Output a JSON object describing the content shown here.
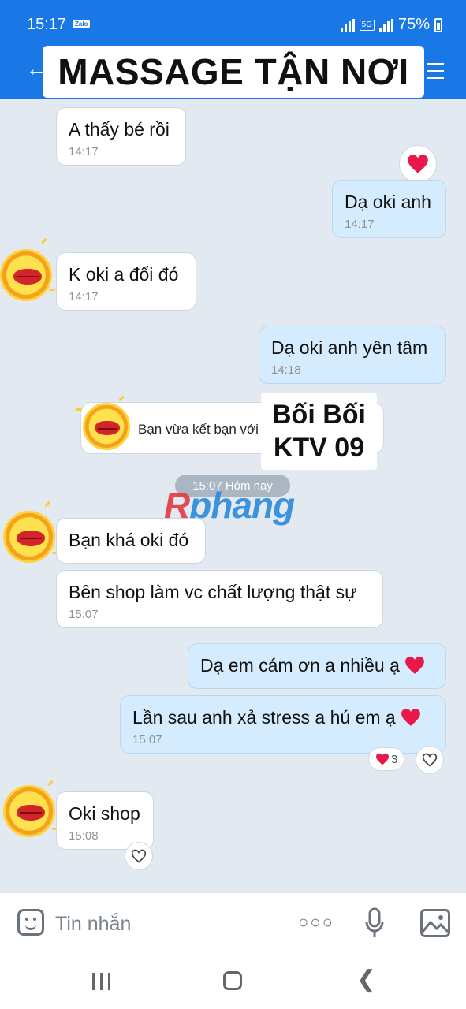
{
  "status_bar": {
    "time": "15:17",
    "app_badge": "Zalo",
    "network": "5G",
    "battery": "75%"
  },
  "header": {
    "title": "MASSAGE TẬN NƠI"
  },
  "messages": [
    {
      "side": "in",
      "text": "A thấy bé rồi",
      "time": "14:17"
    },
    {
      "side": "out",
      "text": "Dạ oki anh",
      "time": "14:17"
    },
    {
      "side": "in",
      "text": "K oki a đổi đó",
      "time": "14:17"
    },
    {
      "side": "out",
      "text": "Dạ oki anh yên tâm",
      "time": "14:18"
    },
    {
      "side": "in",
      "text": "Bạn khá oki đó",
      "time": ""
    },
    {
      "side": "in",
      "text": "Bên shop làm vc chất lượng thật sự",
      "time": "15:07"
    },
    {
      "side": "out",
      "text": "Dạ em cám ơn a nhiều ạ",
      "time": ""
    },
    {
      "side": "out",
      "text": "Lần sau anh xả stress a hú em ạ",
      "time": "15:07"
    },
    {
      "side": "in",
      "text": "Oki shop",
      "time": "15:08"
    }
  ],
  "friend_notice": {
    "text": "Bạn vừa kết bạn với",
    "name_line1": "Bối Bối",
    "name_line2": "KTV 09"
  },
  "date_divider": "15:07 Hôm nay",
  "watermark": {
    "part1": "R",
    "part2": "phang"
  },
  "reaction_count": "3",
  "input": {
    "placeholder": "Tin nhắn"
  },
  "icons": {
    "more": "more-icon",
    "mic": "mic-icon",
    "image": "image-icon",
    "emoji": "emoji-icon"
  },
  "colors": {
    "header_blue": "#1a78e6",
    "outgoing_bubble": "#d4ecfd",
    "chat_background": "#e2e9f1",
    "heart_red": "#e8194a"
  }
}
